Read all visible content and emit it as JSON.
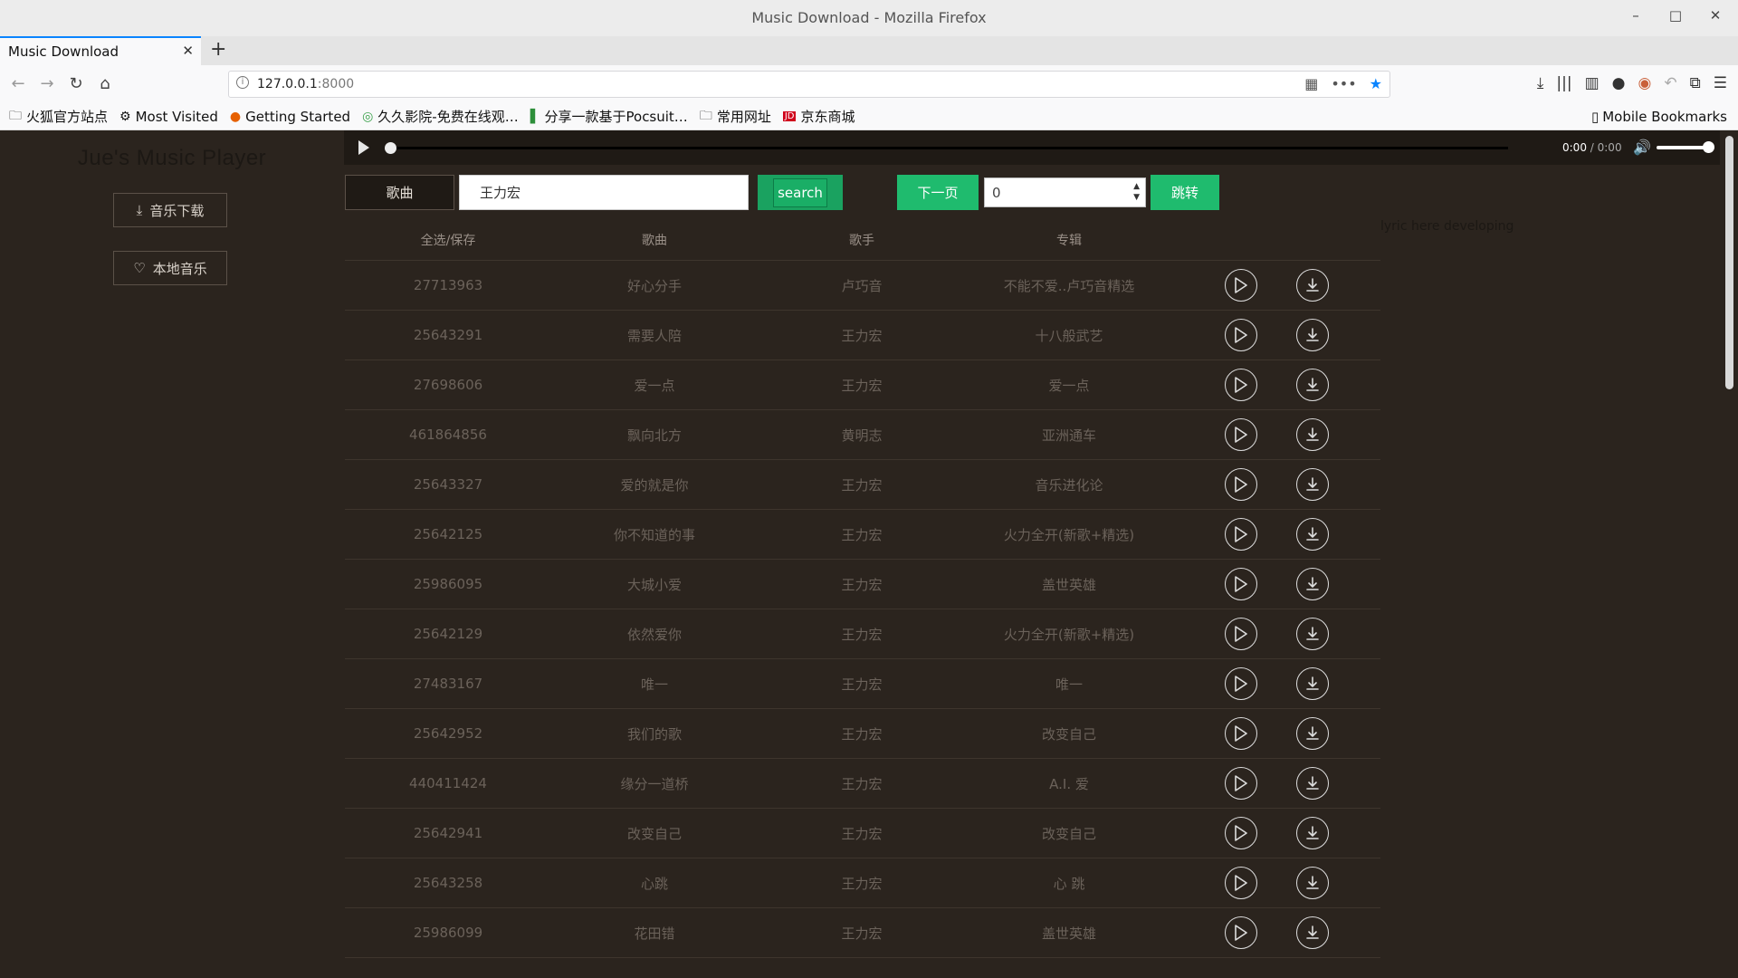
{
  "window": {
    "title": "Music Download - Mozilla Firefox"
  },
  "tab": {
    "label": "Music Download"
  },
  "nav": {
    "url_host": "127.0.0.1",
    "url_port": ":8000"
  },
  "bookmarks": [
    {
      "label": "火狐官方站点",
      "icon": "folder-icon"
    },
    {
      "label": "Most Visited",
      "icon": "gear-icon"
    },
    {
      "label": "Getting Started",
      "icon": "firefox-icon"
    },
    {
      "label": "久久影院-免费在线观…",
      "icon": "globe-icon"
    },
    {
      "label": "分享一款基于Pocsuit…",
      "icon": "bookmark-icon"
    },
    {
      "label": "常用网址",
      "icon": "folder-icon"
    },
    {
      "label": "京东商城",
      "icon": "jd-icon"
    }
  ],
  "mobile_bookmarks": "Mobile Bookmarks",
  "app": {
    "brand": "Jue's Music Player",
    "download_label": "音乐下载",
    "local_label": "本地音乐",
    "time_current": "0:00",
    "time_total": " / 0:00",
    "type_label": "歌曲",
    "search_value": "王力宏",
    "search_label": "search",
    "next_label": "下一页",
    "page_value": "0",
    "jump_label": "跳转",
    "lyric": "lyric here developing"
  },
  "table": {
    "headers": [
      "全选/保存",
      "歌曲",
      "歌手",
      "专辑"
    ],
    "rows": [
      [
        "27713963",
        "好心分手",
        "卢巧音",
        "不能不爱..卢巧音精选"
      ],
      [
        "25643291",
        "需要人陪",
        "王力宏",
        "十八般武艺"
      ],
      [
        "27698606",
        "爱一点",
        "王力宏",
        "爱一点"
      ],
      [
        "461864856",
        "飘向北方",
        "黄明志",
        "亚洲通车"
      ],
      [
        "25643327",
        "爱的就是你",
        "王力宏",
        "音乐进化论"
      ],
      [
        "25642125",
        "你不知道的事",
        "王力宏",
        "火力全开(新歌+精选)"
      ],
      [
        "25986095",
        "大城小爱",
        "王力宏",
        "盖世英雄"
      ],
      [
        "25642129",
        "依然爱你",
        "王力宏",
        "火力全开(新歌+精选)"
      ],
      [
        "27483167",
        "唯一",
        "王力宏",
        "唯一"
      ],
      [
        "25642952",
        "我们的歌",
        "王力宏",
        "改变自己"
      ],
      [
        "440411424",
        "缘分一道桥",
        "王力宏",
        "A.I. 爱"
      ],
      [
        "25642941",
        "改变自己",
        "王力宏",
        "改变自己"
      ],
      [
        "25643258",
        "心跳",
        "王力宏",
        "心 跳"
      ],
      [
        "25986099",
        "花田错",
        "王力宏",
        "盖世英雄"
      ]
    ]
  },
  "player": {
    "progress": 0,
    "volume": 1.0
  }
}
